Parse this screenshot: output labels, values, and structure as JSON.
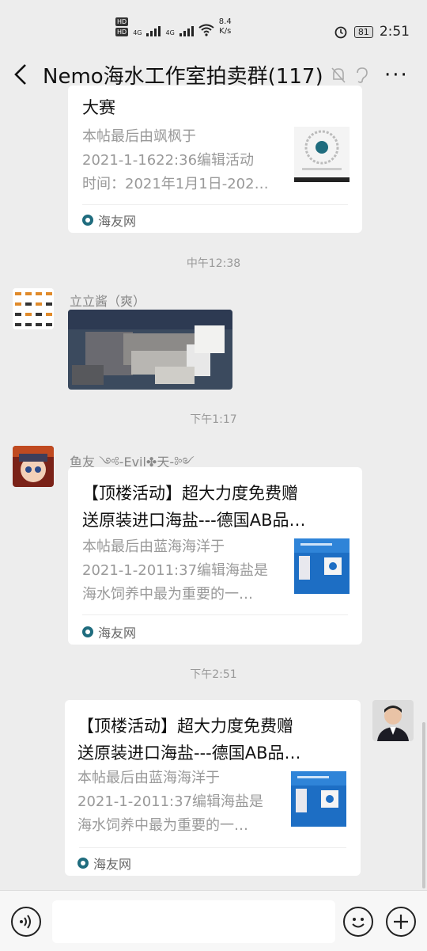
{
  "status": {
    "hd1": "HD",
    "hd2": "HD",
    "net1": "4G",
    "net2": "4G",
    "speed": "8.4",
    "speed_unit": "K/s",
    "battery": "81",
    "clock": "2:51"
  },
  "header": {
    "title": "Nemo海水工作室拍卖群(117)",
    "back_icon": "back-arrow-icon",
    "more_icon": "more-icon"
  },
  "messages": {
    "m1": {
      "title_tail": "大赛",
      "desc": [
        "本帖最后由飒枫于",
        "2021-1-1622:36编辑活动",
        "时间：2021年1月1日-202…"
      ],
      "source": "海友网"
    },
    "t1": "中午12:38",
    "m2": {
      "sender": "立立酱（爽）"
    },
    "t2": "下午1:17",
    "m3": {
      "sender": "鱼友 ༺-Evil✤天-༻",
      "title": [
        "【顶楼活动】超大力度免费赠",
        "送原装进口海盐---德国AB品…"
      ],
      "desc": [
        "本帖最后由蓝海海洋于",
        "2021-1-2011:37编辑海盐是",
        "海水饲养中最为重要的一…"
      ],
      "source": "海友网"
    },
    "t3": "下午2:51",
    "m4": {
      "title": [
        "【顶楼活动】超大力度免费赠",
        "送原装进口海盐---德国AB品…"
      ],
      "desc": [
        "本帖最后由蓝海海洋于",
        "2021-1-2011:37编辑海盐是",
        "海水饲养中最为重要的一…"
      ],
      "source": "海友网"
    }
  },
  "inputbar": {
    "placeholder": ""
  },
  "colors": {
    "background": "#ededed",
    "card": "#ffffff",
    "muted": "#999999"
  }
}
